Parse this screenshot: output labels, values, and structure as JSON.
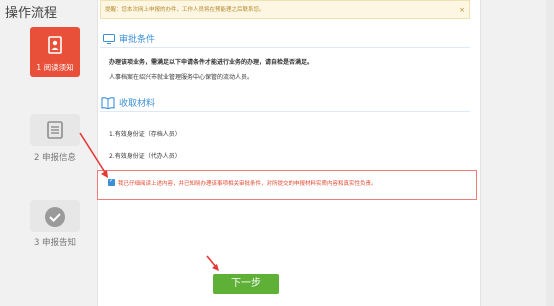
{
  "page_title": "操作流程",
  "notice": {
    "text": "提醒：您本次网上申报的办件，工作人员将在预能理之后联系您。",
    "close": "×"
  },
  "steps": [
    {
      "label": "1 阅读须知"
    },
    {
      "label": "2 申报信息"
    },
    {
      "label": "3 申报告知"
    }
  ],
  "sections": {
    "conditions": {
      "title": "审批条件",
      "lines": [
        "办理该项业务，需满足以下申请条件才能进行业务的办理，请自检是否满足。",
        "人事档案在绍兴市就业管理服务中心保管的流动人员。"
      ]
    },
    "materials": {
      "title": "收取材料",
      "items": [
        "1.有效身份证（存档人员）",
        "2.有效身份证（代办人员）"
      ]
    }
  },
  "agreement": {
    "checked": true,
    "text": "我已仔细阅读上述内容，并已知晓办理该事项相关审批条件，对所提交的申报材料实质内容和真实性负责。"
  },
  "next_button": "下一步",
  "colors": {
    "accent": "#3b8fd8",
    "active_step": "#e8503a",
    "next": "#5fb037",
    "warning": "#e2492f"
  }
}
